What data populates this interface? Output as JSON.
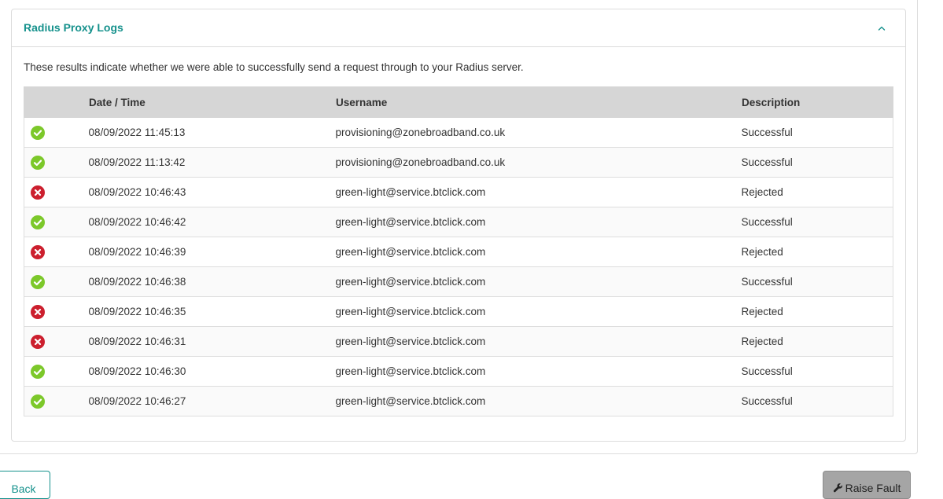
{
  "panel": {
    "title": "Radius Proxy Logs",
    "intro": "These results indicate whether we were able to successfully send a request through to your Radius server."
  },
  "table": {
    "headers": {
      "status": "",
      "datetime": "Date / Time",
      "username": "Username",
      "description": "Description"
    },
    "rows": [
      {
        "status": "success",
        "datetime": "08/09/2022 11:45:13",
        "username": "provisioning@zonebroadband.co.uk",
        "description": "Successful"
      },
      {
        "status": "success",
        "datetime": "08/09/2022 11:13:42",
        "username": "provisioning@zonebroadband.co.uk",
        "description": "Successful"
      },
      {
        "status": "rejected",
        "datetime": "08/09/2022 10:46:43",
        "username": "green-light@service.btclick.com",
        "description": "Rejected"
      },
      {
        "status": "success",
        "datetime": "08/09/2022 10:46:42",
        "username": "green-light@service.btclick.com",
        "description": "Successful"
      },
      {
        "status": "rejected",
        "datetime": "08/09/2022 10:46:39",
        "username": "green-light@service.btclick.com",
        "description": "Rejected"
      },
      {
        "status": "success",
        "datetime": "08/09/2022 10:46:38",
        "username": "green-light@service.btclick.com",
        "description": "Successful"
      },
      {
        "status": "rejected",
        "datetime": "08/09/2022 10:46:35",
        "username": "green-light@service.btclick.com",
        "description": "Rejected"
      },
      {
        "status": "rejected",
        "datetime": "08/09/2022 10:46:31",
        "username": "green-light@service.btclick.com",
        "description": "Rejected"
      },
      {
        "status": "success",
        "datetime": "08/09/2022 10:46:30",
        "username": "green-light@service.btclick.com",
        "description": "Successful"
      },
      {
        "status": "success",
        "datetime": "08/09/2022 10:46:27",
        "username": "green-light@service.btclick.com",
        "description": "Successful"
      }
    ]
  },
  "buttons": {
    "back_label": "Back",
    "raise_fault_label": "Raise Fault"
  },
  "icons": {
    "collapse": "chevron-up-icon",
    "success": "check-circle-icon",
    "rejected": "x-circle-icon",
    "raise_fault": "wrench-icon"
  },
  "colors": {
    "accent": "#15918c",
    "success": "#7cc82a",
    "rejected": "#cc1f2e",
    "table_header_bg": "#d6d6d6"
  }
}
